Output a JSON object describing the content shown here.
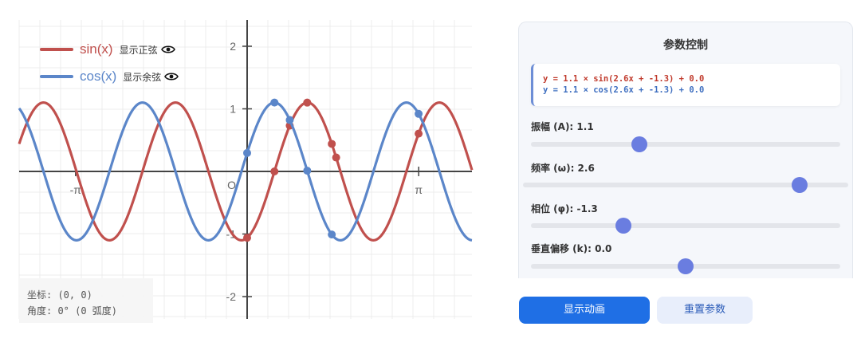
{
  "chart_data": {
    "type": "line",
    "xlim": [
      -4.2,
      4.2
    ],
    "ylim": [
      -2.3,
      2.3
    ],
    "x_ticks": [
      {
        "value": -3.14159,
        "label": "-π"
      },
      {
        "value": 3.14159,
        "label": "π"
      }
    ],
    "y_ticks": [
      {
        "value": 2,
        "label": "2"
      },
      {
        "value": 1,
        "label": "1"
      },
      {
        "value": -1,
        "label": "-1"
      },
      {
        "value": -2,
        "label": "-2"
      }
    ],
    "origin_label": "O",
    "grid": true,
    "legend_position": "top-left",
    "params": {
      "A": 1.1,
      "omega": 2.6,
      "phi": -1.3,
      "k": 0.0
    },
    "series": [
      {
        "name": "sin(x)",
        "color": "#c0504d",
        "func": "sin",
        "points_x": [
          0.0,
          0.5,
          0.78,
          1.1,
          1.55,
          1.63,
          3.14
        ]
      },
      {
        "name": "cos(x)",
        "color": "#5b86c9",
        "func": "cos",
        "points_x": [
          0.0,
          0.5,
          0.78,
          1.1,
          1.55,
          3.14
        ]
      }
    ]
  },
  "legend": {
    "sin": {
      "name": "sin(x)",
      "toggle": "显示正弦",
      "icon": "eye-icon"
    },
    "cos": {
      "name": "cos(x)",
      "toggle": "显示余弦",
      "icon": "eye-icon"
    }
  },
  "coords": {
    "line1": "坐标: (0, 0)",
    "line2": "角度: 0° (0 弧度)"
  },
  "panel": {
    "title": "参数控制",
    "eq_sin": "y = 1.1 × sin(2.6x + -1.3) + 0.0",
    "eq_cos": "y = 1.1 × cos(2.6x + -1.3) + 0.0",
    "params": [
      {
        "label": "振幅 (A): 1.1",
        "fraction": 0.35
      },
      {
        "label": "频率 (ω): 2.6",
        "fraction": 0.85
      },
      {
        "label": "相位 (φ): -1.3",
        "fraction": 0.3
      },
      {
        "label": "垂直偏移 (k): 0.0",
        "fraction": 0.5
      }
    ]
  },
  "buttons": {
    "animate": "显示动画",
    "reset": "重置参数"
  },
  "colors": {
    "sin": "#c0504d",
    "cos": "#5b86c9",
    "accent": "#1f6fe5",
    "slider_thumb": "#6a7de0"
  }
}
